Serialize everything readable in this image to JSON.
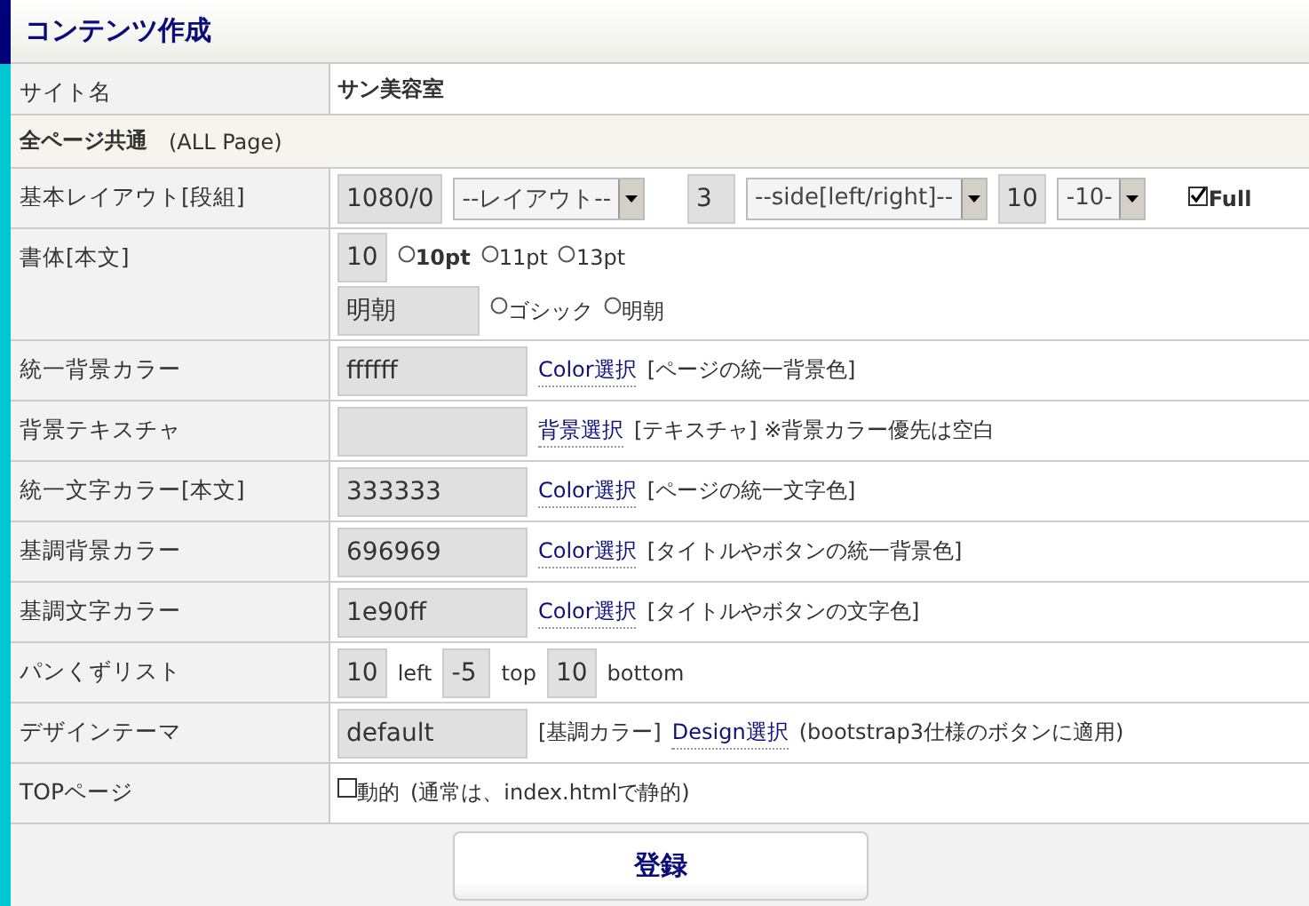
{
  "title": "コンテンツ作成",
  "rows": [
    {
      "kind": "row",
      "label": "サイト名",
      "lines": [
        [
          {
            "kind": "text",
            "text": "サン美容室",
            "bold": true
          }
        ]
      ]
    },
    {
      "kind": "section",
      "label": "全ページ共通",
      "note": "(ALL Page)"
    },
    {
      "kind": "row",
      "label": "基本レイアウト[段組]",
      "lines": [
        [
          {
            "kind": "field",
            "value": "1080/0"
          },
          {
            "kind": "select",
            "value": "--レイアウト--"
          },
          {
            "kind": "gap"
          },
          {
            "kind": "field",
            "value": "3"
          },
          {
            "kind": "select",
            "value": "--side[left/right]--"
          },
          {
            "kind": "field",
            "value": "10"
          },
          {
            "kind": "select",
            "value": "-10-"
          },
          {
            "kind": "gap"
          },
          {
            "kind": "checkbox",
            "label": "Full",
            "checked": true,
            "bold": true
          }
        ]
      ]
    },
    {
      "kind": "row",
      "label": "書体[本文]",
      "lines": [
        [
          {
            "kind": "field",
            "value": "10"
          },
          {
            "kind": "radio",
            "label": "10pt",
            "selected": false,
            "bold": true
          },
          {
            "kind": "radio",
            "label": "11pt",
            "selected": false,
            "bold": false
          },
          {
            "kind": "radio",
            "label": "13pt",
            "selected": false,
            "bold": false
          }
        ],
        [
          {
            "kind": "medium-field",
            "value": "明朝"
          },
          {
            "kind": "radio",
            "label": "ゴシック",
            "selected": false,
            "bold": false
          },
          {
            "kind": "radio",
            "label": "明朝",
            "selected": false,
            "bold": false
          }
        ]
      ]
    },
    {
      "kind": "row",
      "label": "統一背景カラー",
      "lines": [
        [
          {
            "kind": "wide-field",
            "value": "ffffff"
          },
          {
            "kind": "link",
            "text": "Color選択"
          },
          {
            "kind": "text",
            "text": "[ページの統一背景色]"
          }
        ]
      ]
    },
    {
      "kind": "row",
      "label": "背景テキスチャ",
      "lines": [
        [
          {
            "kind": "wide-field"
          },
          {
            "kind": "link",
            "text": "背景選択"
          },
          {
            "kind": "text",
            "text": "[テキスチャ] ※背景カラー優先は空白"
          }
        ]
      ]
    },
    {
      "kind": "row",
      "label": "統一文字カラー[本文]",
      "lines": [
        [
          {
            "kind": "wide-field",
            "value": "333333"
          },
          {
            "kind": "link",
            "text": "Color選択"
          },
          {
            "kind": "text",
            "text": "[ページの統一文字色]"
          }
        ]
      ]
    },
    {
      "kind": "row",
      "label": "基調背景カラー",
      "lines": [
        [
          {
            "kind": "wide-field",
            "value": "696969"
          },
          {
            "kind": "link",
            "text": "Color選択"
          },
          {
            "kind": "text",
            "text": "[タイトルやボタンの統一背景色]"
          }
        ]
      ]
    },
    {
      "kind": "row",
      "label": "基調文字カラー",
      "lines": [
        [
          {
            "kind": "wide-field",
            "value": "1e90ff"
          },
          {
            "kind": "link",
            "text": "Color選択"
          },
          {
            "kind": "text",
            "text": "[タイトルやボタンの文字色]"
          }
        ]
      ]
    },
    {
      "kind": "row",
      "label": "パンくずリスト",
      "lines": [
        [
          {
            "kind": "field",
            "value": "10"
          },
          {
            "kind": "text",
            "text": "left"
          },
          {
            "kind": "field",
            "value": "-5"
          },
          {
            "kind": "text",
            "text": "top"
          },
          {
            "kind": "field",
            "value": "10"
          },
          {
            "kind": "text",
            "text": "bottom"
          }
        ]
      ]
    },
    {
      "kind": "row",
      "label": "デザインテーマ",
      "lines": [
        [
          {
            "kind": "wide-field",
            "value": "default"
          },
          {
            "kind": "text",
            "text": "[基調カラー]"
          },
          {
            "kind": "link",
            "text": "Design選択"
          },
          {
            "kind": "text",
            "text": "(bootstrap3仕様のボタンに適用)"
          }
        ]
      ]
    },
    {
      "kind": "row",
      "label": "TOPページ",
      "lines": [
        [
          {
            "kind": "checkbox",
            "label": "動的",
            "checked": false,
            "bold": false
          },
          {
            "kind": "text",
            "text": "(通常は、index.htmlで静的)"
          }
        ]
      ]
    }
  ],
  "submit": "登録"
}
